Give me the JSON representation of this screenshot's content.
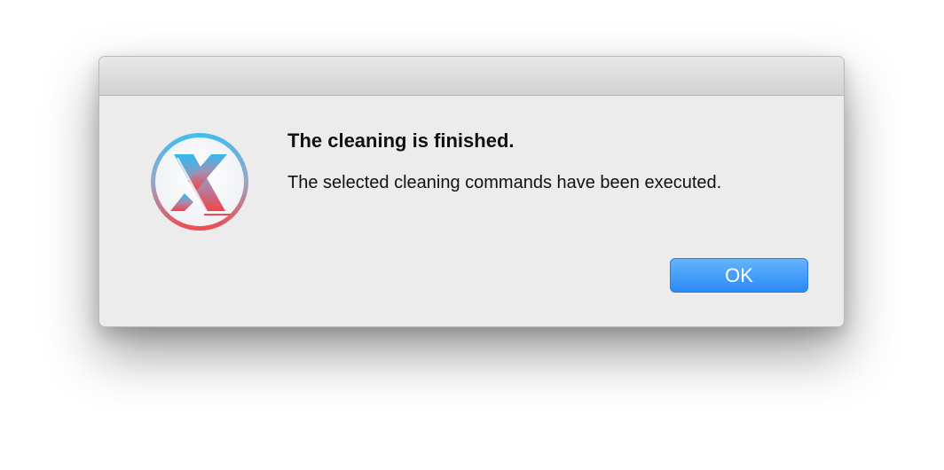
{
  "dialog": {
    "title": "The cleaning is finished.",
    "message": "The selected cleaning commands have been executed.",
    "ok_label": "OK"
  },
  "icon": {
    "name": "onyx-app-icon",
    "letter": "X",
    "gradient_top": "#3fbdf0",
    "gradient_bottom": "#f04a4e"
  },
  "colors": {
    "button_accent": "#2a8af6"
  }
}
